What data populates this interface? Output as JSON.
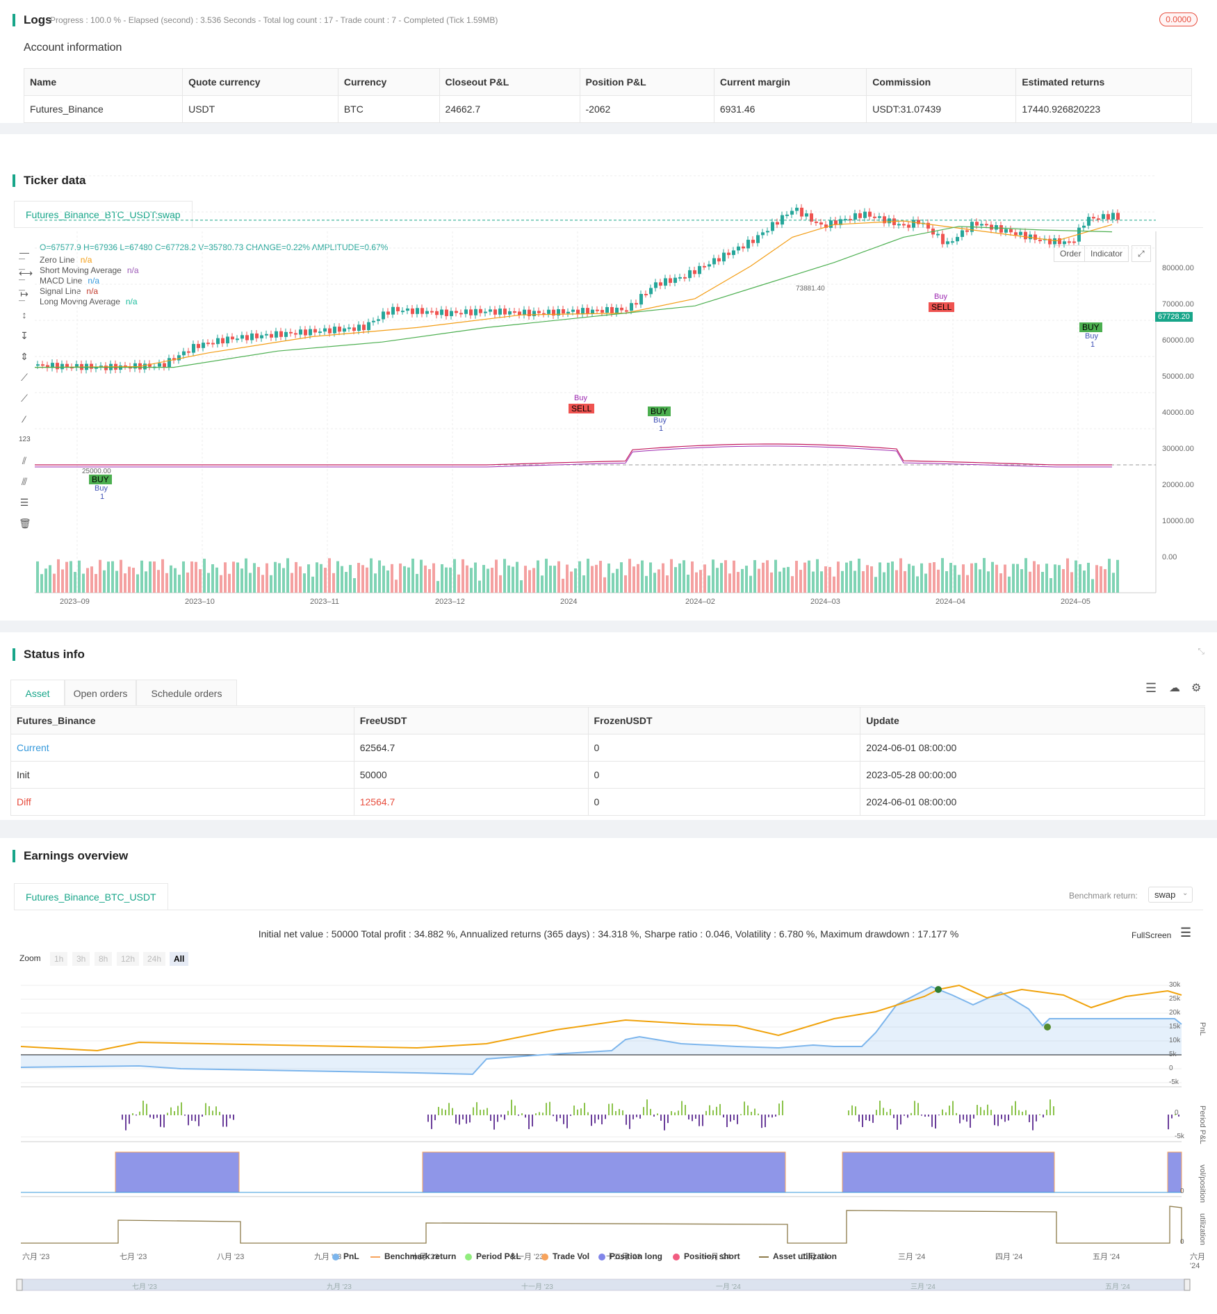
{
  "logs": {
    "title": "Logs",
    "progress": "Progress : 100.0 % - Elapsed (second) : 3.536  Seconds - Total log count : 17 - Trade count : 7 - Completed (Tick 1.59MB)",
    "badge": "0.0000"
  },
  "account": {
    "title": "Account information",
    "headers": [
      "Name",
      "Quote currency",
      "Currency",
      "Closeout P&L",
      "Position P&L",
      "Current margin",
      "Commission",
      "Estimated returns"
    ],
    "row": [
      "Futures_Binance",
      "USDT",
      "BTC",
      "24662.7",
      "-2062",
      "6931.46",
      "USDT:31.07439",
      "17440.926820223"
    ]
  },
  "ticker": {
    "title": "Ticker data",
    "tab": "Futures_Binance_BTC_USDT:swap",
    "ohlc": "O=67577.9 H=67936 L=67480 C=67728.2 V=35780.73 CHANGE=0.22% AMPLITUDE=0.67%",
    "legend": [
      {
        "name": "Zero Line",
        "value": "n/a",
        "color": "#f39c12"
      },
      {
        "name": "Short Moving Average",
        "value": "n/a",
        "color": "#9b59b6"
      },
      {
        "name": "MACD Line",
        "value": "n/a",
        "color": "#3498db"
      },
      {
        "name": "Signal Line",
        "value": "n/a",
        "color": "#c0392b"
      },
      {
        "name": "Long Moving Average",
        "value": "n/a",
        "color": "#1abc9c"
      }
    ],
    "buttons": {
      "order": "Order",
      "indicator": "Indicator"
    },
    "price_tag": "67728.20",
    "high_label": "73881.40",
    "low_label": "25000.00",
    "y_ticks": [
      "80000.00",
      "70000.00",
      "60000.00",
      "50000.00",
      "40000.00",
      "30000.00",
      "20000.00",
      "10000.00",
      "0.00"
    ],
    "x_ticks": [
      "2023–09",
      "2023–10",
      "2023–11",
      "2023–12",
      "2024",
      "2024–02",
      "2024–03",
      "2024–04",
      "2024–05"
    ],
    "signals": [
      {
        "type": "BUY",
        "sub": "Buy",
        "num": "1"
      },
      {
        "type": "SELL",
        "sub": "Buy",
        "num": ""
      },
      {
        "type": "BUY",
        "sub": "Buy",
        "num": "1"
      },
      {
        "type": "SELL",
        "sub": "Buy",
        "num": ""
      },
      {
        "type": "BUY",
        "sub": "Buy",
        "num": "1"
      }
    ]
  },
  "status": {
    "title": "Status info",
    "tabs": [
      "Asset",
      "Open orders",
      "Schedule orders"
    ],
    "headers": [
      "Futures_Binance",
      "FreeUSDT",
      "FrozenUSDT",
      "Update"
    ],
    "rows": [
      [
        "Current",
        "62564.7",
        "0",
        "2024-06-01 08:00:00"
      ],
      [
        "Init",
        "50000",
        "0",
        "2023-05-28 00:00:00"
      ],
      [
        "Diff",
        "12564.7",
        "0",
        "2024-06-01 08:00:00"
      ]
    ]
  },
  "earnings": {
    "title": "Earnings overview",
    "tab": "Futures_Binance_BTC_USDT",
    "benchmark_label": "Benchmark return:",
    "benchmark_value": "swap",
    "summary": "Initial net value : 50000 Total profit : 34.882 %, Annualized returns (365 days) : 34.318 %, Sharpe ratio : 0.046, Volatility : 6.780 %, Maximum drawdown : 17.177 %",
    "fullscreen": "FullScreen",
    "zoom_label": "Zoom",
    "zoom_options": [
      "1h",
      "3h",
      "8h",
      "12h",
      "24h",
      "All"
    ],
    "pnl_ticks": [
      "30k",
      "25k",
      "20k",
      "15k",
      "10k",
      "5k",
      "0",
      "-5k"
    ],
    "period_ticks": [
      "0",
      "-5k"
    ],
    "pos_ticks": [
      "0"
    ],
    "util_ticks": [
      "0"
    ],
    "panel_labels": [
      "PnL",
      "Period P&L",
      "vol/position",
      "utilization"
    ],
    "x_ticks": [
      "六月 '23",
      "七月 '23",
      "八月 '23",
      "九月 '23",
      "十月 '23",
      "十一月 '23",
      "十二月 '23",
      "一月 '24",
      "二月 '24",
      "三月 '24",
      "四月 '24",
      "五月 '24",
      "六月 '24"
    ],
    "nav_ticks": [
      "七月 '23",
      "九月 '23",
      "十一月 '23",
      "一月 '24",
      "三月 '24",
      "五月 '24"
    ],
    "legend": [
      {
        "name": "PnL",
        "color": "#7cb5ec"
      },
      {
        "name": "Benchmark return",
        "color": "#f7a35c"
      },
      {
        "name": "Period P&L",
        "color": "#90ed7d"
      },
      {
        "name": "Trade Vol",
        "color": "#f7a35c"
      },
      {
        "name": "Position long",
        "color": "#8085e9"
      },
      {
        "name": "Position short",
        "color": "#f15c80"
      },
      {
        "name": "Asset utilization",
        "color": "#8d7b4a"
      }
    ]
  },
  "colors": {
    "accent": "#17a589",
    "up": "#26a69a",
    "down": "#ef5350",
    "diff": "#e74c3c",
    "link": "#3498db"
  }
}
